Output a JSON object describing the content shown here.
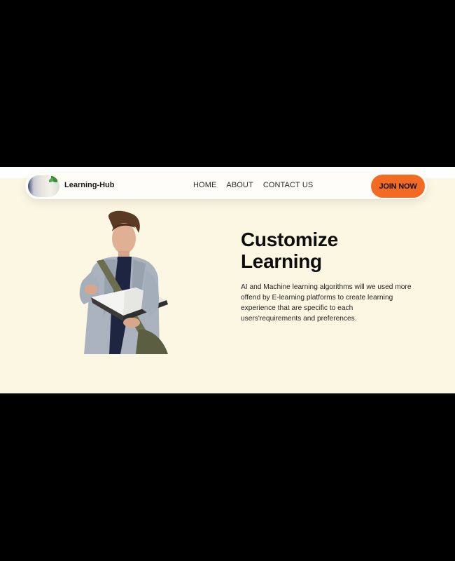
{
  "navbar": {
    "brand": "Learning-Hub",
    "links": [
      "HOME",
      "ABOUT",
      "CONTACT US"
    ],
    "cta": "JOIN NOW"
  },
  "hero": {
    "title_line1": "Customize",
    "title_line2": "Learning",
    "description": "AI and Machine learning algorithms will we used more offend by E-learning platforms to create learning experience that are specific to each users'requirements and preferences."
  },
  "colors": {
    "background": "#fcf7e3",
    "accent": "#f36a22",
    "frame": "#000000"
  }
}
